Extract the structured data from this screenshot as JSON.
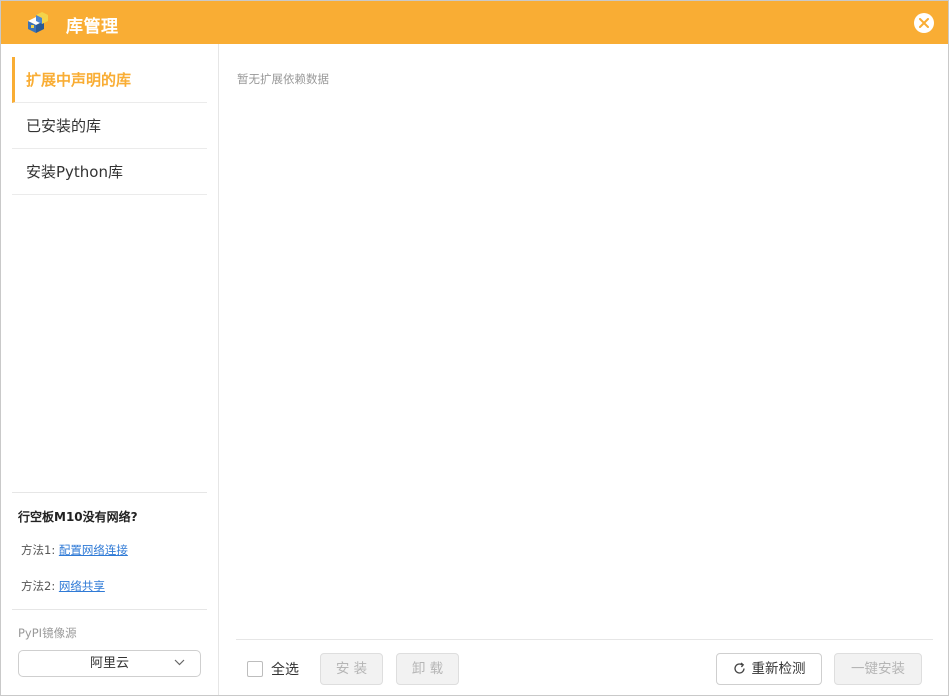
{
  "window": {
    "title": "库管理"
  },
  "sidebar": {
    "items": [
      {
        "label": "扩展中声明的库",
        "active": true
      },
      {
        "label": "已安装的库",
        "active": false
      },
      {
        "label": "安装Python库",
        "active": false
      }
    ],
    "help": {
      "title": "行空板M10没有网络?",
      "method1_prefix": "方法1:",
      "method1_link": "配置网络连接",
      "method2_prefix": "方法2:",
      "method2_link": "网络共享"
    },
    "mirror": {
      "label": "PyPI镜像源",
      "selected": "阿里云"
    }
  },
  "main": {
    "empty_text": "暂无扩展依赖数据"
  },
  "footer": {
    "select_all_label": "全选",
    "install_label": "安 装",
    "uninstall_label": "卸 载",
    "recheck_label": "重新检测",
    "one_click_install_label": "一键安装"
  },
  "colors": {
    "accent": "#f9ad34",
    "link": "#2f7ad6"
  }
}
